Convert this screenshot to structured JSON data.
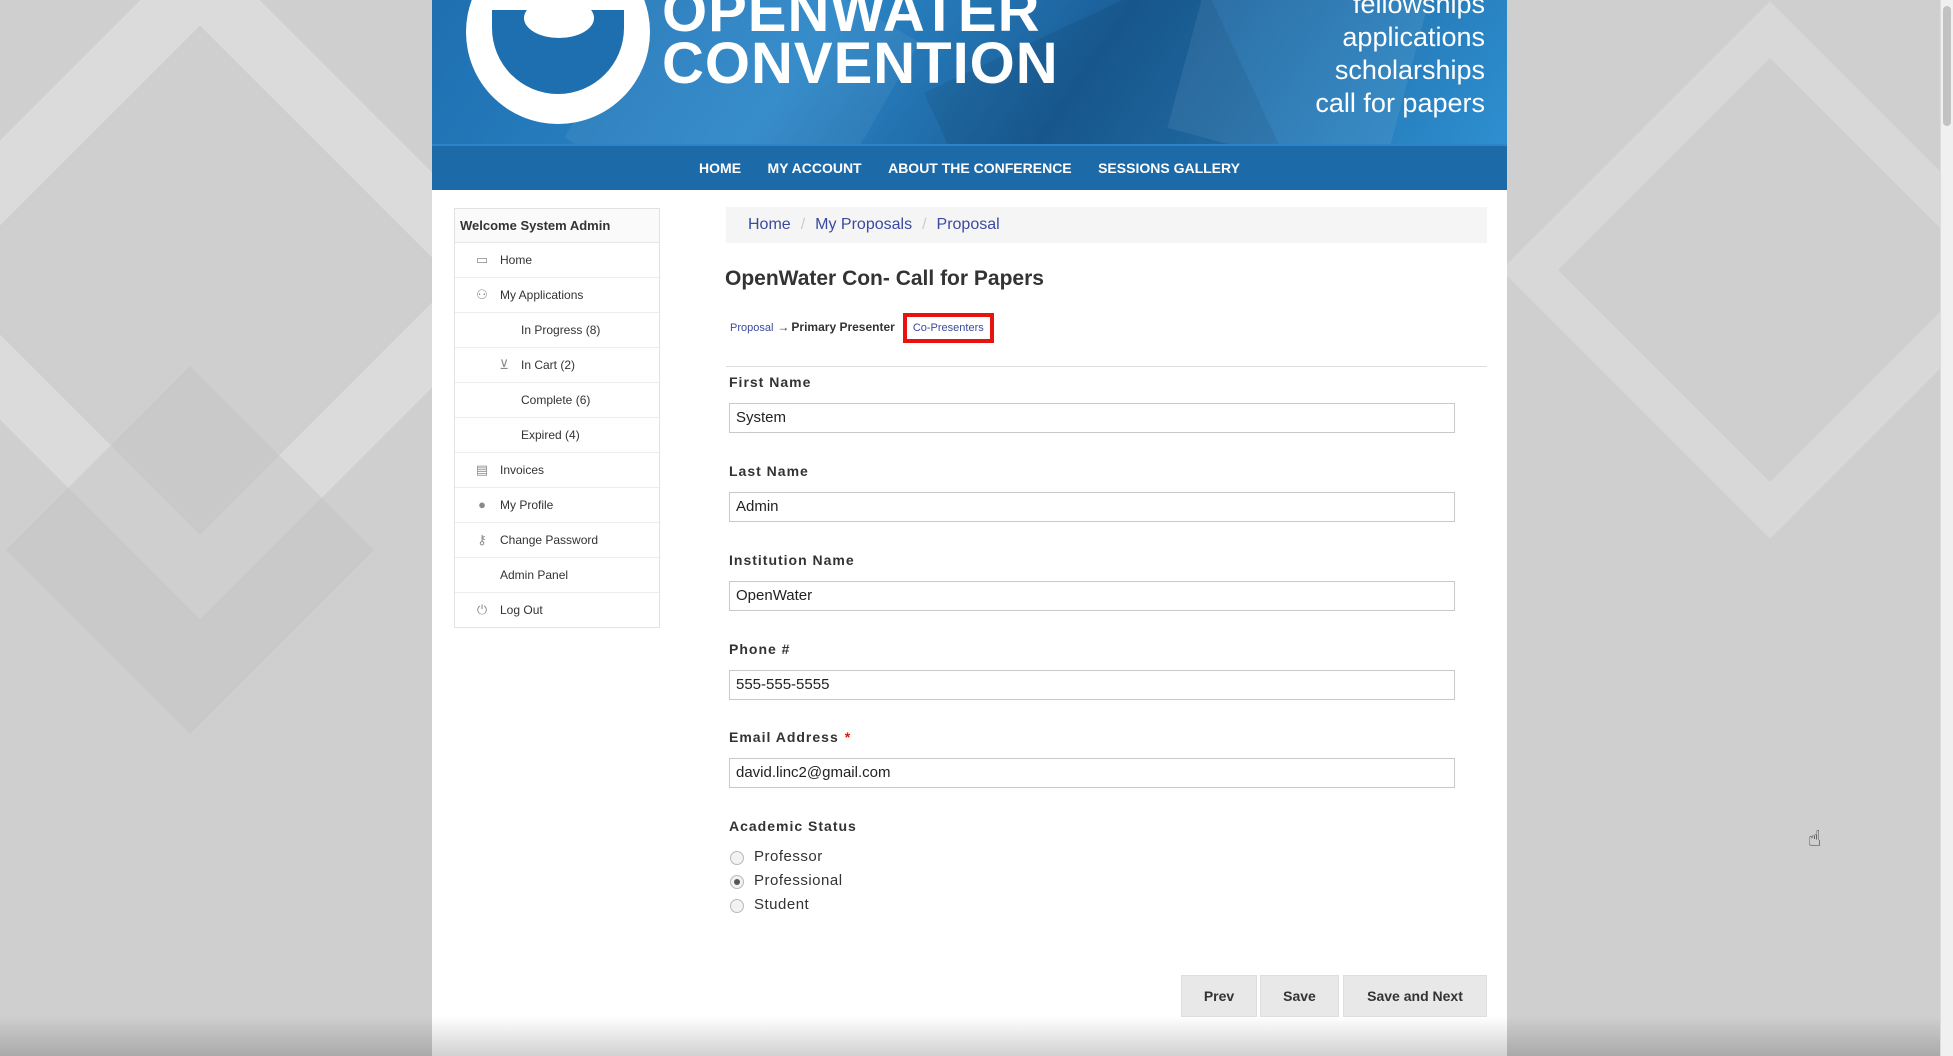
{
  "banner": {
    "logo_line1": "OPENWATER",
    "logo_line2": "CONVENTION",
    "words": [
      "fellowships",
      "applications",
      "scholarships",
      "call for papers"
    ]
  },
  "nav": {
    "items": [
      "HOME",
      "MY ACCOUNT",
      "ABOUT THE CONFERENCE",
      "SESSIONS GALLERY"
    ]
  },
  "sidebar": {
    "welcome": "Welcome System Admin",
    "items": [
      {
        "label": "Home",
        "icon": "home-icon"
      },
      {
        "label": "My Applications",
        "icon": "applications-icon"
      },
      {
        "label": "In Progress (8)",
        "icon": ""
      },
      {
        "label": "In Cart (2)",
        "icon": "cart-icon"
      },
      {
        "label": "Complete (6)",
        "icon": ""
      },
      {
        "label": "Expired (4)",
        "icon": ""
      },
      {
        "label": "Invoices",
        "icon": "invoice-icon"
      },
      {
        "label": "My Profile",
        "icon": "user-icon"
      },
      {
        "label": "Change Password",
        "icon": "key-icon"
      },
      {
        "label": "Admin Panel",
        "icon": ""
      },
      {
        "label": "Log Out",
        "icon": "power-icon"
      }
    ]
  },
  "breadcrumb": {
    "items": [
      "Home",
      "My Proposals",
      "Proposal"
    ],
    "separator": "/"
  },
  "form": {
    "title": "OpenWater Con- Call for Papers",
    "steps": {
      "proposal": "Proposal",
      "arrow": "→",
      "primary_presenter": "Primary Presenter",
      "co_presenters": "Co-Presenters"
    },
    "fields": {
      "first_name": {
        "label": "First Name",
        "value": "System"
      },
      "last_name": {
        "label": "Last Name",
        "value": "Admin"
      },
      "institution": {
        "label": "Institution Name",
        "value": "OpenWater"
      },
      "phone": {
        "label": "Phone #",
        "value": "555-555-5555"
      },
      "email": {
        "label": "Email Address",
        "required_mark": "*",
        "value": "david.linc2@gmail.com"
      }
    },
    "academic_status": {
      "label": "Academic Status",
      "options": [
        "Professor",
        "Professional",
        "Student"
      ],
      "selected": "Professional"
    },
    "buttons": {
      "prev": "Prev",
      "save": "Save",
      "save_next": "Save and Next"
    }
  },
  "colors": {
    "nav_bg": "#1d6aa8",
    "link": "#3a4a9f",
    "highlight_border": "#e8120f"
  }
}
